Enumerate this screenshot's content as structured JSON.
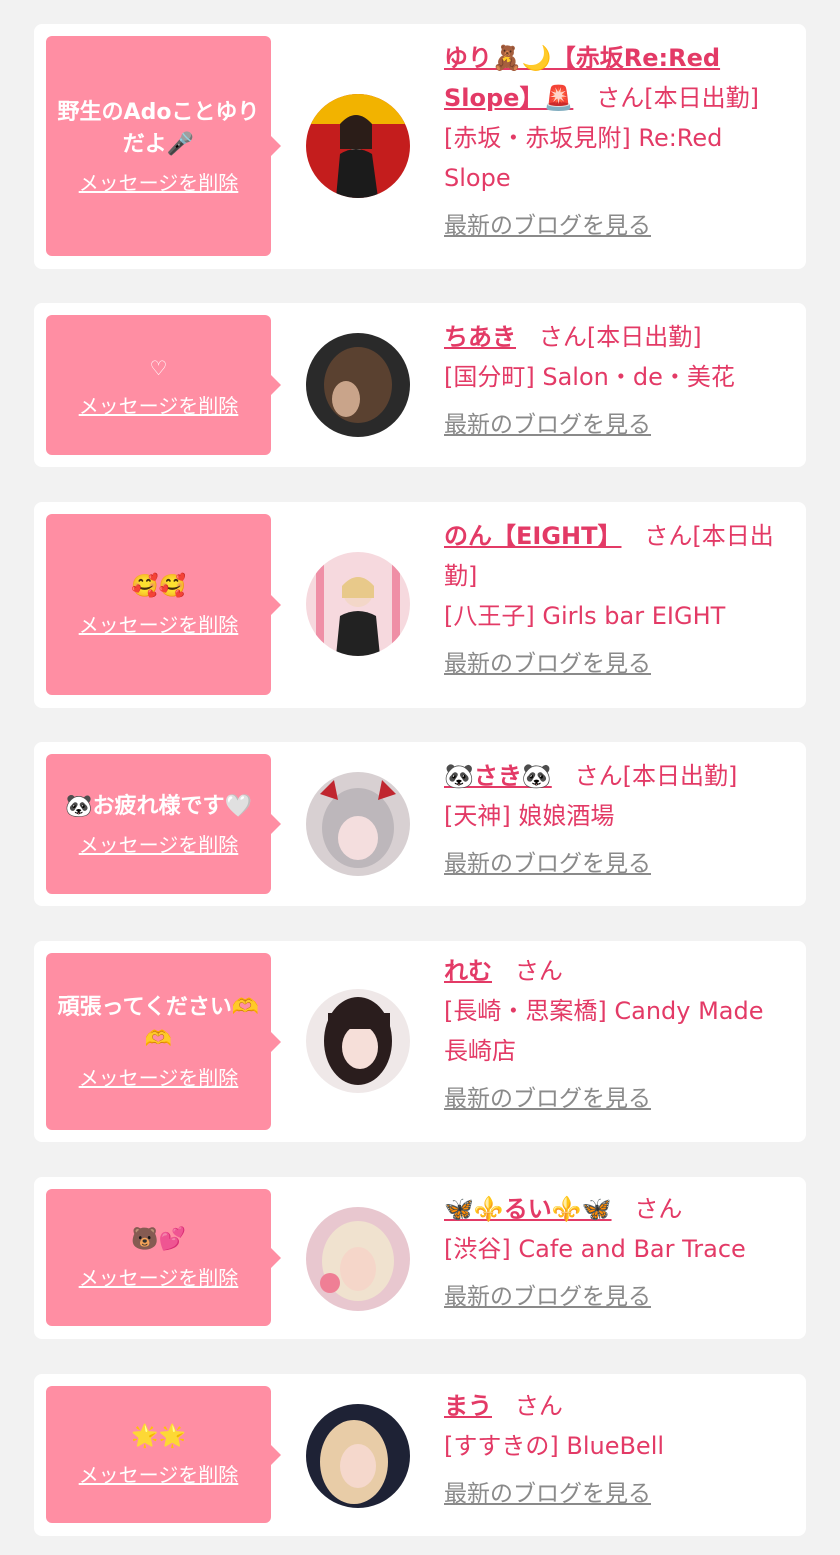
{
  "common": {
    "delete_label": "メッセージを削除",
    "blog_label": "最新のブログを見る",
    "san_suffix": "さん",
    "accent_color": "#e33a66",
    "bubble_color": "#ff8ea3"
  },
  "items": [
    {
      "message": "野生のAdoことゆりだよ🎤",
      "name": "ゆり🧸🌙【赤坂Re:Red Slope】🚨",
      "status": "[本日出勤]",
      "location": "[赤坂・赤坂見附] Re:Red Slope"
    },
    {
      "message": "♡",
      "name": "ちあき",
      "status": "[本日出勤]",
      "location": "[国分町] Salon・de・美花"
    },
    {
      "message": "🥰🥰",
      "name": "のん【EIGHT】",
      "status": "[本日出勤]",
      "location": "[八王子] Girls bar EIGHT"
    },
    {
      "message": "🐼お疲れ様です🤍",
      "name": "🐼さき🐼",
      "status": "[本日出勤]",
      "location": "[天神] 娘娘酒場"
    },
    {
      "message": "頑張ってください🫶🫶",
      "name": "れむ",
      "status": "",
      "location": "[長崎・思案橋] Candy Made 長崎店"
    },
    {
      "message": "🐻💕",
      "name": "🦋⚜️るい⚜️🦋",
      "status": "",
      "location": "[渋谷] Cafe and Bar Trace"
    },
    {
      "message": "🌟🌟",
      "name": "まう",
      "status": "",
      "location": "[すすきの] BlueBell"
    }
  ]
}
